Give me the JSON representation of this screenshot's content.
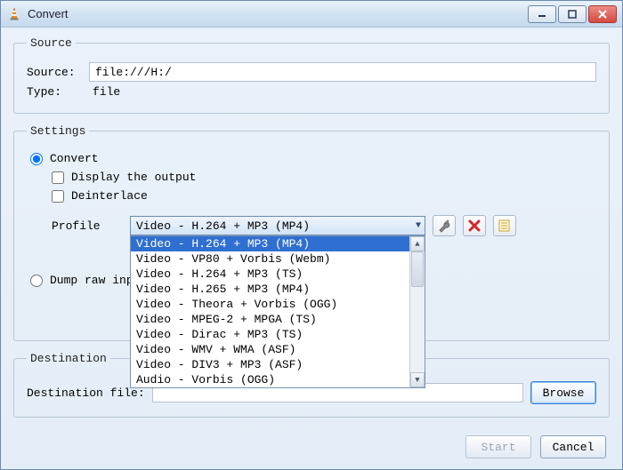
{
  "window": {
    "title": "Convert",
    "icon_name": "vlc-cone-icon"
  },
  "source": {
    "legend": "Source",
    "label": "Source:",
    "value": "file:///H:/",
    "type_label": "Type:",
    "type_value": "file"
  },
  "settings": {
    "legend": "Settings",
    "convert_label": "Convert",
    "dump_label": "Dump raw input",
    "display_output_label": "Display the output",
    "deinterlace_label": "Deinterlace",
    "profile_label": "Profile",
    "profile_selected": "Video - H.264 + MP3 (MP4)",
    "profile_options": [
      "Video - H.264 + MP3 (MP4)",
      "Video - VP80 + Vorbis (Webm)",
      "Video - H.264 + MP3 (TS)",
      "Video - H.265 + MP3 (MP4)",
      "Video - Theora + Vorbis (OGG)",
      "Video - MPEG-2 + MPGA (TS)",
      "Video - Dirac + MP3 (TS)",
      "Video - WMV + WMA (ASF)",
      "Video - DIV3 + MP3 (ASF)",
      "Audio - Vorbis (OGG)"
    ],
    "tool_icons": {
      "edit": "wrench-icon",
      "delete": "delete-icon",
      "new": "new-profile-icon"
    }
  },
  "destination": {
    "legend": "Destination",
    "label": "Destination file:",
    "value": "",
    "browse_label": "Browse"
  },
  "footer": {
    "start_label": "Start",
    "cancel_label": "Cancel"
  }
}
